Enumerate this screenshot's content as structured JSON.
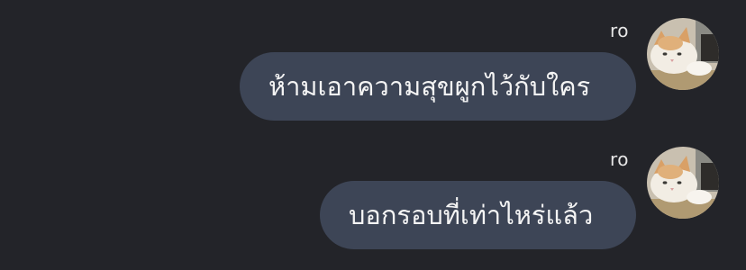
{
  "messages": [
    {
      "sender": "ro",
      "text": "ห้ามเอาความสุขผูกไว้กับใคร",
      "avatar": "cat-avatar"
    },
    {
      "sender": "ro",
      "text": "บอกรอบที่เท่าไหร่แล้ว",
      "avatar": "cat-avatar"
    }
  ],
  "colors": {
    "background": "#232429",
    "bubble": "#3d4556",
    "text": "#f4f4f4"
  }
}
